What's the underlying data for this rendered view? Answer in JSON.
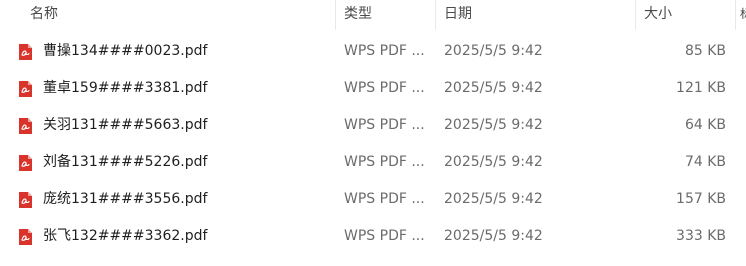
{
  "header": {
    "name": "名称",
    "type": "类型",
    "date": "日期",
    "size": "大小",
    "extra": "标"
  },
  "files": [
    {
      "name": "曹操134####0023.pdf",
      "type": "WPS PDF ...",
      "date": "2025/5/5 9:42",
      "size": "85 KB",
      "icon": "pdf-icon"
    },
    {
      "name": "董卓159####3381.pdf",
      "type": "WPS PDF ...",
      "date": "2025/5/5 9:42",
      "size": "121 KB",
      "icon": "pdf-icon"
    },
    {
      "name": "关羽131####5663.pdf",
      "type": "WPS PDF ...",
      "date": "2025/5/5 9:42",
      "size": "64 KB",
      "icon": "pdf-icon"
    },
    {
      "name": "刘备131####5226.pdf",
      "type": "WPS PDF ...",
      "date": "2025/5/5 9:42",
      "size": "74 KB",
      "icon": "pdf-icon"
    },
    {
      "name": "庞统131####3556.pdf",
      "type": "WPS PDF ...",
      "date": "2025/5/5 9:42",
      "size": "157 KB",
      "icon": "pdf-icon"
    },
    {
      "name": "张飞132####3362.pdf",
      "type": "WPS PDF ...",
      "date": "2025/5/5 9:42",
      "size": "333 KB",
      "icon": "pdf-icon"
    }
  ],
  "colors": {
    "pdf_icon": "#d9342b"
  }
}
